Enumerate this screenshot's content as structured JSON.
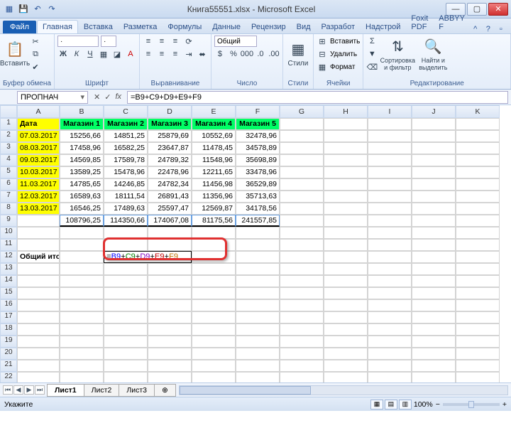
{
  "title": "Книга55551.xlsx - Microsoft Excel",
  "tabs": {
    "file": "Файл",
    "items": [
      "Главная",
      "Вставка",
      "Разметка",
      "Формулы",
      "Данные",
      "Рецензир",
      "Вид",
      "Разработ",
      "Надстрой",
      "Foxit PDF",
      "ABBYY F"
    ]
  },
  "ribbon": {
    "paste": "Вставить",
    "clipboard_label": "Буфер обмена",
    "font_name": "·",
    "font_size": "·",
    "font_label": "Шрифт",
    "align_label": "Выравнивание",
    "number_format": "Общий",
    "number_label": "Число",
    "styles": "Стили",
    "styles_label": "Стили",
    "insert": "Вставить",
    "delete": "Удалить",
    "format": "Формат",
    "cells_label": "Ячейки",
    "sort": "Сортировка и фильтр",
    "find": "Найти и выделить",
    "edit_label": "Редактирование"
  },
  "formula_bar": {
    "name_box": "ПРОПНАЧ",
    "formula": "=B9+C9+D9+E9+F9"
  },
  "columns": [
    "A",
    "B",
    "C",
    "D",
    "E",
    "F",
    "G",
    "H",
    "I",
    "J",
    "K"
  ],
  "headers": {
    "date": "Дата",
    "stores": [
      "Магазин 1",
      "Магазин 2",
      "Магазин 3",
      "Магазин 4",
      "Магазин 5"
    ]
  },
  "rows": [
    {
      "date": "07.03.2017",
      "v": [
        "15256,66",
        "14851,25",
        "25879,69",
        "10552,69",
        "32478,96"
      ]
    },
    {
      "date": "08.03.2017",
      "v": [
        "17458,96",
        "16582,25",
        "23647,87",
        "11478,45",
        "34578,89"
      ]
    },
    {
      "date": "09.03.2017",
      "v": [
        "14569,85",
        "17589,78",
        "24789,32",
        "11548,96",
        "35698,89"
      ]
    },
    {
      "date": "10.03.2017",
      "v": [
        "13589,25",
        "15478,96",
        "22478,96",
        "12211,65",
        "33478,96"
      ]
    },
    {
      "date": "11.03.2017",
      "v": [
        "14785,65",
        "14246,85",
        "24782,34",
        "11456,98",
        "36529,89"
      ]
    },
    {
      "date": "12.03.2017",
      "v": [
        "16589,63",
        "18111,54",
        "26891,43",
        "11356,96",
        "35713,63"
      ]
    },
    {
      "date": "13.03.2017",
      "v": [
        "16546,25",
        "17489,63",
        "25597,47",
        "12569,87",
        "34178,56"
      ]
    }
  ],
  "sums": [
    "108796,25",
    "114350,66",
    "174067,08",
    "81175,56",
    "241557,85"
  ],
  "total_label": "Общий итог",
  "editing_formula": "=B9+C9+D9+E9+F9",
  "sheets": [
    "Лист1",
    "Лист2",
    "Лист3"
  ],
  "status": {
    "mode": "Укажите",
    "zoom": "100%"
  }
}
